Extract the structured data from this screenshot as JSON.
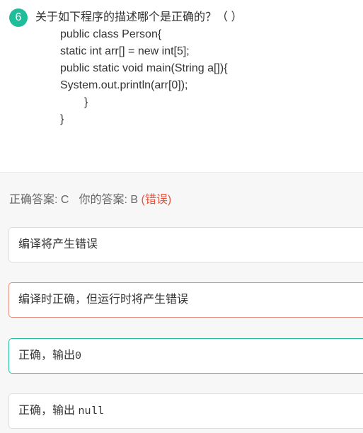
{
  "question": {
    "number": "6",
    "title": "关于如下程序的描述哪个是正确的？（ ）",
    "code_lines": [
      "public class Person{",
      "static int arr[] = new int[5];",
      "public static void main(String a[]){",
      "System.out.println(arr[0]);",
      "}",
      "}"
    ]
  },
  "answer": {
    "correct_label": "正确答案: C",
    "your_label": "你的答案: B",
    "status": "(错误)"
  },
  "options": [
    {
      "text": "编译将产生错误",
      "code": "",
      "state": "normal"
    },
    {
      "text": "编译时正确，但运行时将产生错误",
      "code": "",
      "state": "wrong"
    },
    {
      "text": "正确，输出",
      "code": "0",
      "state": "correct"
    },
    {
      "text": "正确，输出 ",
      "code": "null",
      "state": "normal"
    }
  ],
  "colors": {
    "accent": "#1fbd99",
    "error": "#e6553f",
    "background": "#f7f7f7"
  }
}
